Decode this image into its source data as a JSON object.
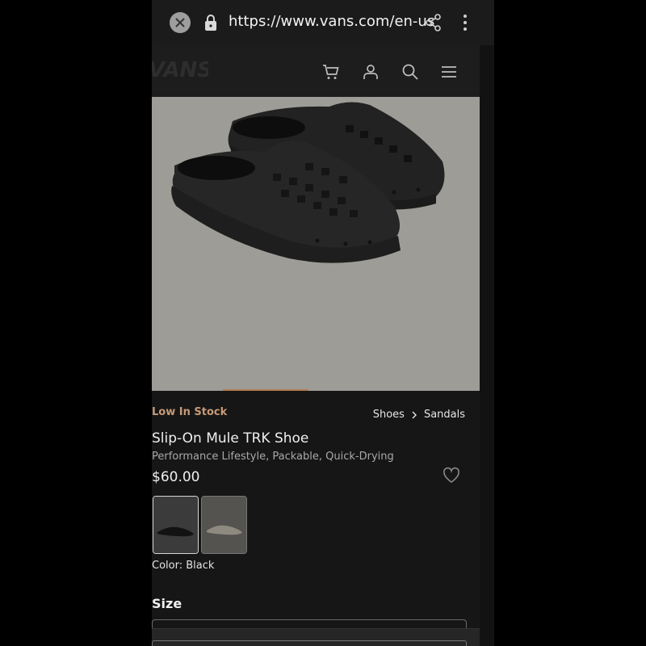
{
  "browser": {
    "url": "https://www.vans.com/en-us",
    "icons": {
      "close": "close-icon",
      "lock": "lock-icon",
      "share": "share-icon",
      "menu": "more-vertical-icon"
    }
  },
  "site": {
    "logo_text": "VANS",
    "nav_icons": [
      "cart-icon",
      "account-icon",
      "search-icon",
      "hamburger-menu-icon"
    ]
  },
  "product": {
    "stock_status": "Low In Stock",
    "breadcrumb": [
      "Shoes",
      "Sandals"
    ],
    "title": "Slip-On Mule TRK Shoe",
    "subtitle": "Performance Lifestyle, Packable, Quick-Drying",
    "price": "$60.00",
    "color_label": "Color: Black",
    "size_label": "Size",
    "swatches": [
      "Black",
      "Taupe"
    ],
    "colors": {
      "stock": "#c79a78",
      "hero_bg": "#9d9c97",
      "indicator": "#b27d56"
    }
  }
}
